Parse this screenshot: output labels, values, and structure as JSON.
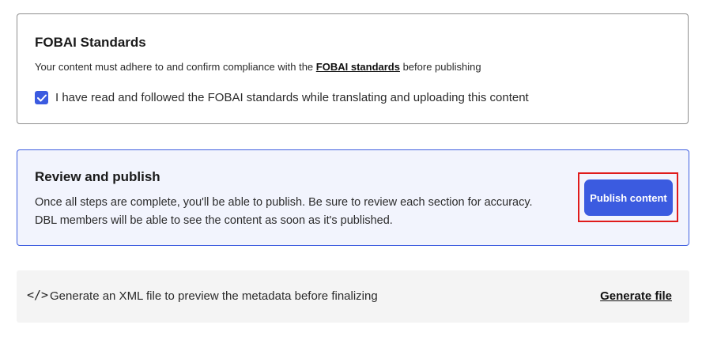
{
  "standards": {
    "title": "FOBAI Standards",
    "desc_prefix": "Your content must adhere to and confirm compliance with the ",
    "desc_link": "FOBAI standards",
    "desc_suffix": " before publishing",
    "checkbox_checked": true,
    "checkbox_label": "I have read and followed the FOBAI standards while translating and uploading this content"
  },
  "review": {
    "title": "Review and publish",
    "line1": "Once all steps are complete, you'll be able to publish. Be sure to review each section for accuracy.",
    "line2": "DBL members will be able to see the content as soon as it's published.",
    "publish_label": "Publish content"
  },
  "xml": {
    "icon": "code-icon",
    "text": "Generate an XML file to preview the metadata before finalizing",
    "link_label": "Generate file"
  },
  "colors": {
    "accent": "#3b5be0",
    "highlight": "#e01b1b",
    "review_bg": "#f2f4fd",
    "xml_bg": "#f4f4f4"
  }
}
